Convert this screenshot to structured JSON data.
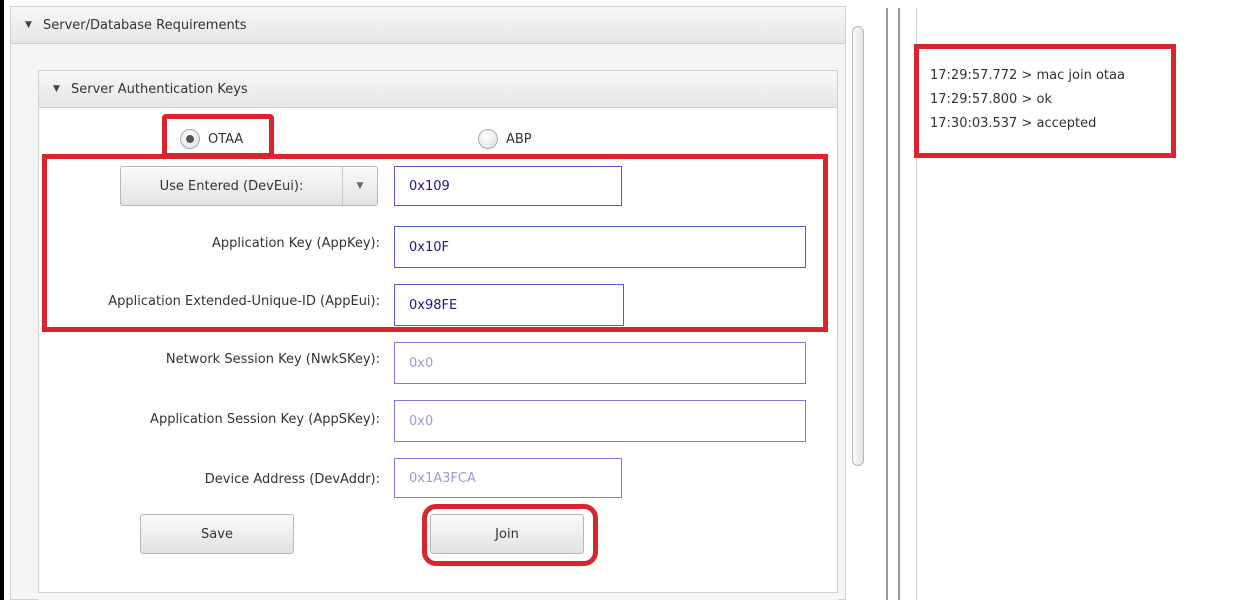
{
  "outer_section": {
    "title": "Server/Database Requirements",
    "collapse_icon": "triangle-down-icon"
  },
  "inner_section": {
    "title": "Server Authentication Keys",
    "collapse_icon": "triangle-down-icon"
  },
  "join_mode": {
    "options": [
      {
        "label": "OTAA",
        "selected": true
      },
      {
        "label": "ABP",
        "selected": false
      }
    ]
  },
  "deveui_select": {
    "selected": "Use Entered (DevEui):",
    "arrow_icon": "chevron-down-icon"
  },
  "fields": {
    "deveui": {
      "value": "0x109"
    },
    "appkey": {
      "label": "Application Key (AppKey):",
      "value": "0x10F"
    },
    "appeui": {
      "label": "Application Extended-Unique-ID (AppEui):",
      "value": "0x98FE"
    },
    "nwkskey": {
      "label": "Network Session Key (NwkSKey):",
      "value": "0x0"
    },
    "appskey": {
      "label": "Application Session Key (AppSKey):",
      "value": "0x0"
    },
    "devaddr": {
      "label": "Device Address (DevAddr):",
      "value": "0x1A3FCA"
    }
  },
  "buttons": {
    "save": "Save",
    "join": "Join"
  },
  "log": {
    "lines": [
      "17:29:57.772 > mac join otaa",
      "17:29:57.800 > ok",
      "17:30:03.537 > accepted"
    ]
  },
  "colors": {
    "highlight": "#d9262c",
    "field_border": "#5a5ad0",
    "field_text": "#1a1a8a"
  }
}
